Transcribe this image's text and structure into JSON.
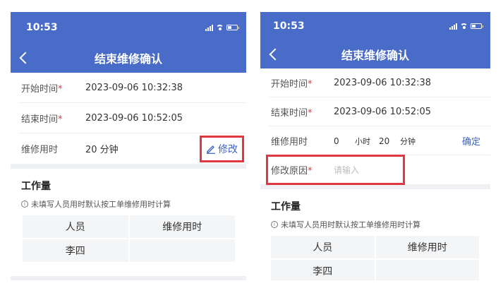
{
  "left": {
    "status_time": "10:53",
    "title": "结束维修确认",
    "rows": [
      {
        "label": "开始时间",
        "value": "2023-09-06 10:32:38"
      },
      {
        "label": "结束时间",
        "value": "2023-09-06 10:52:05"
      },
      {
        "label": "维修用时",
        "value": "20 分钟"
      }
    ],
    "edit_label": "修改",
    "workload_title": "工作量",
    "hint": "未填写人员用时默认按工单维修用时计算",
    "table_headers": [
      "人员",
      "维修用时"
    ],
    "table_rows": [
      [
        "李四",
        ""
      ]
    ]
  },
  "right": {
    "status_time": "10:53",
    "title": "结束维修确认",
    "rows": [
      {
        "label": "开始时间",
        "value": "2023-09-06 10:32:38"
      },
      {
        "label": "结束时间",
        "value": "2023-09-06 10:52:05"
      }
    ],
    "duration_label": "维修用时",
    "hours_value": "0",
    "hours_unit": "小时",
    "minutes_value": "20",
    "minutes_unit": "分钟",
    "confirm_label": "确定",
    "reason_label": "修改原因",
    "reason_placeholder": "请输入",
    "workload_title": "工作量",
    "hint": "未填写人员用时默认按工单维修用时计算",
    "table_headers": [
      "人员",
      "维修用时"
    ],
    "table_rows": [
      [
        "李四",
        ""
      ]
    ]
  },
  "colors": {
    "header": "#4a6cc9",
    "accent": "#3d63c9",
    "required": "#e0383e",
    "highlight_box": "#e0383e"
  },
  "icons": [
    "back-chevron-icon",
    "signal-icon",
    "wifi-icon",
    "battery-icon",
    "pencil-icon",
    "info-icon"
  ]
}
